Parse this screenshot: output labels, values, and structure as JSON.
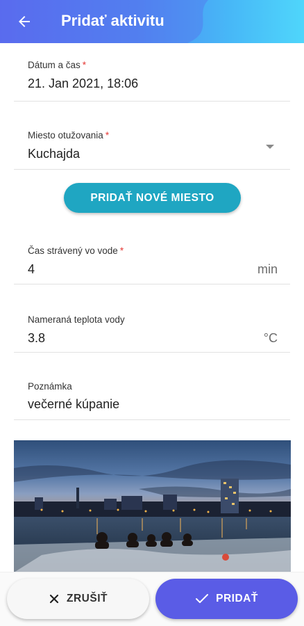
{
  "header": {
    "title": "Pridať aktivitu"
  },
  "form": {
    "datetime": {
      "label": "Dátum a čas",
      "required_mark": "*",
      "value": "21. Jan 2021, 18:06"
    },
    "place": {
      "label": "Miesto otužovania",
      "required_mark": "*",
      "value": "Kuchajda"
    },
    "add_place_label": "PRIDAŤ NOVÉ MIESTO",
    "time_in_water": {
      "label": "Čas strávený vo vode",
      "required_mark": "*",
      "value": "4",
      "unit": "min"
    },
    "water_temp": {
      "label": "Nameraná teplota vody",
      "value": "3.8",
      "unit": "°C"
    },
    "note": {
      "label": "Poznámka",
      "value": "večerné kúpanie"
    }
  },
  "actions": {
    "cancel_label": "ZRUŠIŤ",
    "add_label": "PRIDAŤ"
  },
  "colors": {
    "accent": "#5a5ce6",
    "secondary": "#1fa6c2",
    "required": "#e53935"
  },
  "icons": {
    "back": "arrow-left-icon",
    "dropdown": "caret-down-icon",
    "cancel": "close-icon",
    "confirm": "check-icon"
  }
}
